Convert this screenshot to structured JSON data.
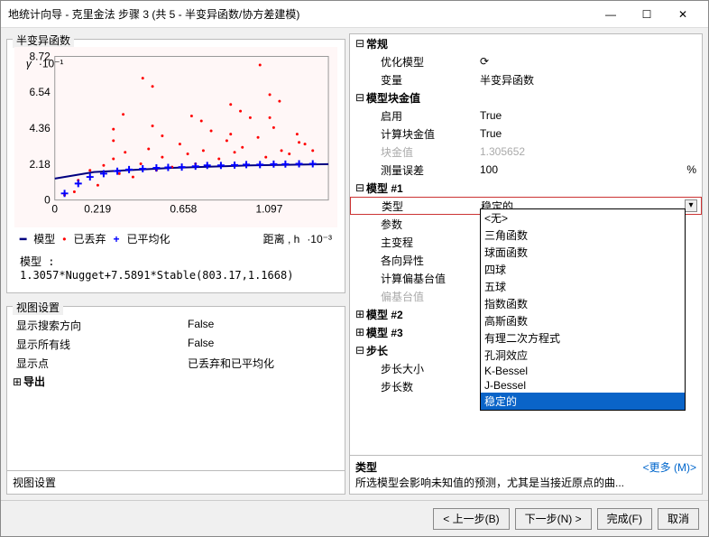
{
  "window": {
    "title": "地统计向导 - 克里金法 步骤 3 (共 5 - 半变异函数/协方差建模)",
    "min_icon": "—",
    "max_icon": "☐",
    "close_icon": "✕"
  },
  "left": {
    "group_title": "半变异函数",
    "y_axis_label": "γ",
    "y_axis_scale": "·10⁻¹",
    "x_axis_label": "距离 , h",
    "x_axis_scale": "·10⁻³",
    "legend": {
      "model": "模型",
      "discarded": "已丢弃",
      "averaged": "已平均化"
    },
    "formula": "模型 : 1.3057*Nugget+7.5891*Stable(803.17,1.1668)",
    "view_settings_title": "视图设置",
    "vs": {
      "show_search_dir_k": "显示搜索方向",
      "show_search_dir_v": "False",
      "show_all_lines_k": "显示所有线",
      "show_all_lines_v": "False",
      "show_points_k": "显示点",
      "show_points_v": "已丢弃和已平均化"
    },
    "export_title": "导出",
    "bottom_label": "视图设置"
  },
  "props": {
    "general": "常规",
    "opt_model_k": "优化模型",
    "opt_model_icon": "⟳",
    "variable_k": "变量",
    "variable_v": "半变异函数",
    "nugget_section": "模型块金值",
    "enabled_k": "启用",
    "enabled_v": "True",
    "calc_nugget_k": "计算块金值",
    "calc_nugget_v": "True",
    "nugget_k": "块金值",
    "nugget_v": "1.305652",
    "meas_err_k": "测量误差",
    "meas_err_v": "100",
    "meas_err_unit": "%",
    "model1": "模型 #1",
    "type_k": "类型",
    "type_v": "稳定的",
    "params_k": "参数",
    "range_k": "主变程",
    "aniso_k": "各向异性",
    "calc_sill_k": "计算偏基台值",
    "sill_k": "偏基台值",
    "model2": "模型 #2",
    "model3": "模型 #3",
    "step_section": "步长",
    "step_size_k": "步长大小",
    "step_count_k": "步长数"
  },
  "dropdown": {
    "options": [
      "<无>",
      "三角函数",
      "球面函数",
      "四球",
      "五球",
      "指数函数",
      "高斯函数",
      "有理二次方程式",
      "孔洞效应",
      "K-Bessel",
      "J-Bessel",
      "稳定的"
    ],
    "selected": "稳定的"
  },
  "help": {
    "title": "类型",
    "more": "<更多 (M)>",
    "text": "所选模型会影响未知值的预测，尤其是当接近原点的曲..."
  },
  "footer": {
    "back": "< 上一步(B)",
    "next": "下一步(N) >",
    "finish": "完成(F)",
    "cancel": "取消"
  },
  "chart_data": {
    "type": "scatter",
    "title": "半变异函数",
    "xlabel": "距离 , h ·10⁻³",
    "ylabel": "γ ·10⁻¹",
    "xlim": [
      0,
      1.4
    ],
    "ylim": [
      0,
      8.72
    ],
    "x_ticks": [
      0,
      0.219,
      0.658,
      1.097
    ],
    "y_ticks": [
      0,
      2.18,
      4.36,
      6.54,
      8.72
    ],
    "series": [
      {
        "name": "模型",
        "type": "line",
        "color": "navy",
        "x": [
          0,
          0.2,
          0.6,
          1.0,
          1.4
        ],
        "y": [
          1.3,
          1.7,
          1.95,
          2.1,
          2.18
        ]
      },
      {
        "name": "已丢弃",
        "type": "points",
        "color": "red",
        "x": [
          0.05,
          0.1,
          0.12,
          0.18,
          0.22,
          0.25,
          0.3,
          0.33,
          0.36,
          0.4,
          0.44,
          0.48,
          0.52,
          0.55,
          0.6,
          0.64,
          0.68,
          0.72,
          0.76,
          0.8,
          0.84,
          0.88,
          0.92,
          0.96,
          1.0,
          1.04,
          1.08,
          1.12,
          1.16,
          1.2,
          1.24,
          1.28,
          1.32,
          0.3,
          0.5,
          0.7,
          0.9,
          1.1,
          0.55,
          0.75,
          0.95,
          1.15,
          0.45,
          0.5,
          1.05,
          0.35,
          0.3,
          0.9,
          1.25,
          1.1
        ],
        "y": [
          0.3,
          0.5,
          1.2,
          1.8,
          0.9,
          2.1,
          2.5,
          1.6,
          2.9,
          1.4,
          2.2,
          3.1,
          1.8,
          2.6,
          2.0,
          3.4,
          2.8,
          2.2,
          3.0,
          4.2,
          2.5,
          3.6,
          2.9,
          3.2,
          5.0,
          3.8,
          2.6,
          4.4,
          3.0,
          2.8,
          4.0,
          3.4,
          3.0,
          3.6,
          4.5,
          5.1,
          5.8,
          6.4,
          3.9,
          4.8,
          5.4,
          6.0,
          7.4,
          6.9,
          8.2,
          5.2,
          4.3,
          4.0,
          3.5,
          5.0
        ]
      },
      {
        "name": "已平均化",
        "type": "points",
        "color": "blue",
        "x": [
          0.05,
          0.12,
          0.18,
          0.25,
          0.32,
          0.38,
          0.45,
          0.52,
          0.58,
          0.65,
          0.72,
          0.78,
          0.85,
          0.92,
          0.98,
          1.05,
          1.12,
          1.18,
          1.25,
          1.32
        ],
        "y": [
          0.4,
          1.0,
          1.4,
          1.6,
          1.75,
          1.85,
          1.9,
          1.95,
          1.98,
          2.0,
          2.05,
          2.1,
          2.1,
          2.12,
          2.15,
          2.15,
          2.18,
          2.18,
          2.2,
          2.2
        ]
      }
    ]
  }
}
